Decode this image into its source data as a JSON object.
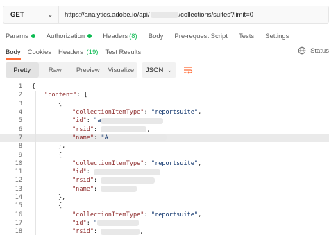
{
  "request": {
    "method": "GET",
    "url_prefix": "https://analytics.adobe.io/api/",
    "url_suffix": "/collections/suites?limit=0"
  },
  "request_tabs": [
    {
      "label": "Params",
      "dot": true
    },
    {
      "label": "Authorization",
      "dot": true
    },
    {
      "label": "Headers",
      "count": "(8)"
    },
    {
      "label": "Body"
    },
    {
      "label": "Pre-request Script"
    },
    {
      "label": "Tests"
    },
    {
      "label": "Settings"
    }
  ],
  "response_tabs": {
    "body": "Body",
    "cookies": "Cookies",
    "headers": "Headers",
    "headers_count": "(19)",
    "test_results": "Test Results",
    "status": "Status"
  },
  "toolbar": {
    "pretty": "Pretty",
    "raw": "Raw",
    "preview": "Preview",
    "visualize": "Visualize",
    "format": "JSON"
  },
  "code": {
    "line_numbers": [
      "1",
      "2",
      "3",
      "4",
      "5",
      "6",
      "7",
      "8",
      "9",
      "10",
      "11",
      "12",
      "13",
      "14",
      "15",
      "16",
      "17",
      "18"
    ],
    "brace_open": "{",
    "content_key": "\"content\"",
    "bracket_open": "[",
    "obj_open": "{",
    "obj_close_comma": "},",
    "k_type": "\"collectionItemType\"",
    "v_type": "\"reportsuite\"",
    "k_id": "\"id\"",
    "k_rsid": "\"rsid\"",
    "k_name": "\"name\"",
    "v_id_partial": "\"a",
    "v_name_partial": "\"A",
    "v_quote": "\"",
    "colon": ": ",
    "comma": ","
  },
  "colors": {
    "accent": "#ff6c37",
    "green": "#0cbb52",
    "json_key": "#8f2d2d",
    "json_string": "#0a3069"
  }
}
